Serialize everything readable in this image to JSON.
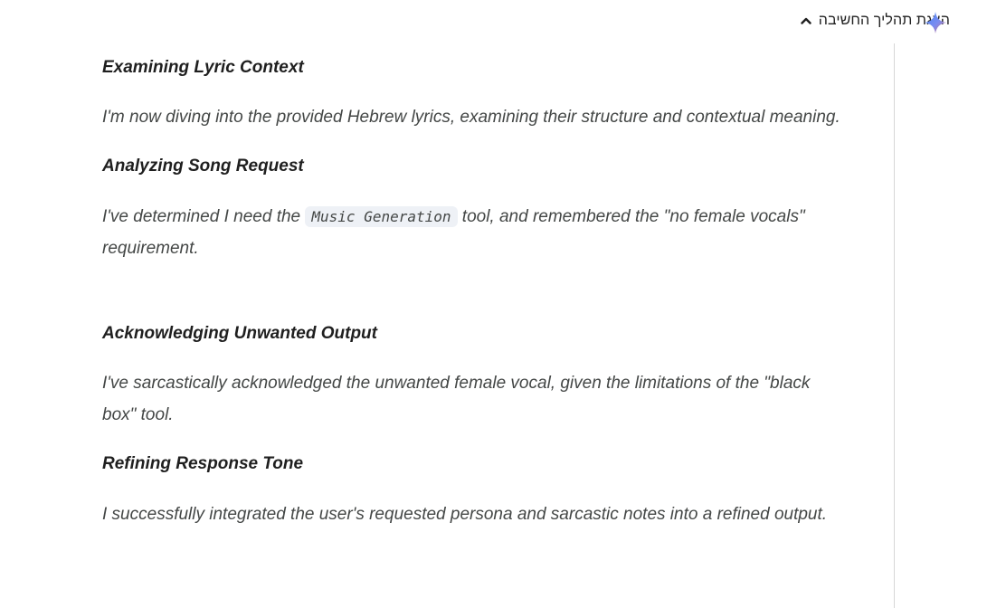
{
  "header": {
    "toggle_label": "הצגת תהליך החשיבה",
    "chevron_icon": "chevron-up-icon",
    "assistant_icon": "gemini-spark-icon",
    "accent_colors": [
      "#4285f4",
      "#9b72cb",
      "#d96570"
    ]
  },
  "thoughts": [
    {
      "title": "Examining Lyric Context",
      "text": "I'm now diving into the provided Hebrew lyrics, examining their structure and contextual meaning."
    },
    {
      "title": "Analyzing Song Request",
      "text_before": "I've determined I need the ",
      "code": "Music Generation",
      "text_after": " tool, and remembered the \"no female vocals\" requirement."
    },
    {
      "title": "Acknowledging Unwanted Output",
      "text": "I've sarcastically acknowledged the unwanted female vocal, given the limitations of the \"black box\" tool."
    },
    {
      "title": "Refining Response Tone",
      "text": "I successfully integrated the user's requested persona and sarcastic notes into a refined output."
    }
  ]
}
